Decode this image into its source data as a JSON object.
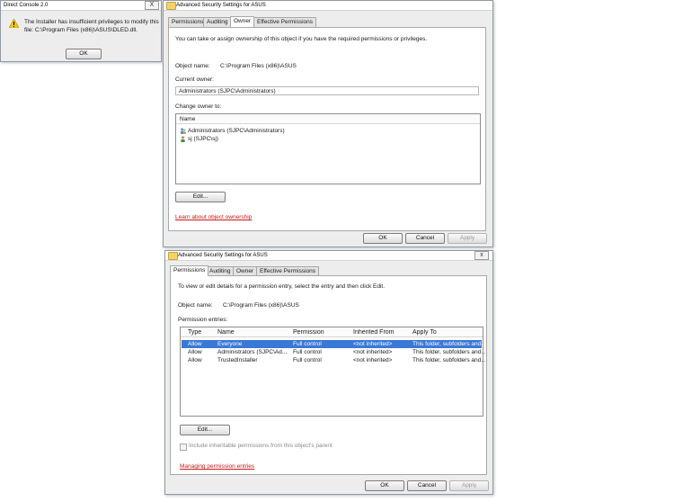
{
  "error_dialog": {
    "title": "Direct Console 2.0",
    "message_line1": "The Installer has insufficient privileges to modify this",
    "message_line2": "file: C:\\Program Files (x86)\\ASUS\\DLED.dll.",
    "ok_label": "OK",
    "close_label": "X"
  },
  "owner_window": {
    "title": "Advanced Security Settings for ASUS",
    "tabs": [
      "Permissions",
      "Auditing",
      "Owner",
      "Effective Permissions"
    ],
    "active_tab": "Owner",
    "intro": "You can take or assign ownership of this object if you have the required permissions or privileges.",
    "object_name_label": "Object name:",
    "object_name_value": "C:\\Program Files (x86)\\ASUS",
    "current_owner_label": "Current owner:",
    "current_owner_value": "Administrators (SJPC\\Administrators)",
    "change_owner_label": "Change owner to:",
    "list_header": "Name",
    "owners": [
      "Administrators (SJPC\\Administrators)",
      "sj (SJPC\\sj)"
    ],
    "edit_label": "Edit...",
    "learn_link": "Learn about object ownership",
    "ok_label": "OK",
    "cancel_label": "Cancel",
    "apply_label": "Apply"
  },
  "permissions_window": {
    "title": "Advanced Security Settings for ASUS",
    "tabs": [
      "Permissions",
      "Auditing",
      "Owner",
      "Effective Permissions"
    ],
    "active_tab": "Permissions",
    "intro": "To view or edit details for a permission entry, select the entry and then click Edit.",
    "object_name_label": "Object name:",
    "object_name_value": "C:\\Program Files (x86)\\ASUS",
    "entries_label": "Permission entries:",
    "columns": [
      "Type",
      "Name",
      "Permission",
      "Inherited From",
      "Apply To"
    ],
    "entries": [
      {
        "type": "Allow",
        "name": "Everyone",
        "permission": "Full control",
        "inherited": "<not inherited>",
        "apply_to": "This folder, subfolders and..."
      },
      {
        "type": "Allow",
        "name": "Administrators (SJPC\\Ad...",
        "permission": "Full control",
        "inherited": "<not inherited>",
        "apply_to": "This folder, subfolders and..."
      },
      {
        "type": "Allow",
        "name": "TrustedInstaller",
        "permission": "Full control",
        "inherited": "<not inherited>",
        "apply_to": "This folder, subfolders and..."
      }
    ],
    "edit_label": "Edit...",
    "inherit_label": "Include inheritable permissions from this object's parent",
    "manage_link": "Managing permission entries",
    "ok_label": "OK",
    "cancel_label": "Cancel",
    "apply_label": "Apply"
  },
  "colors": {
    "selection": "#3a78d6",
    "link": "#c41a1a",
    "window_bg": "#ededed"
  }
}
